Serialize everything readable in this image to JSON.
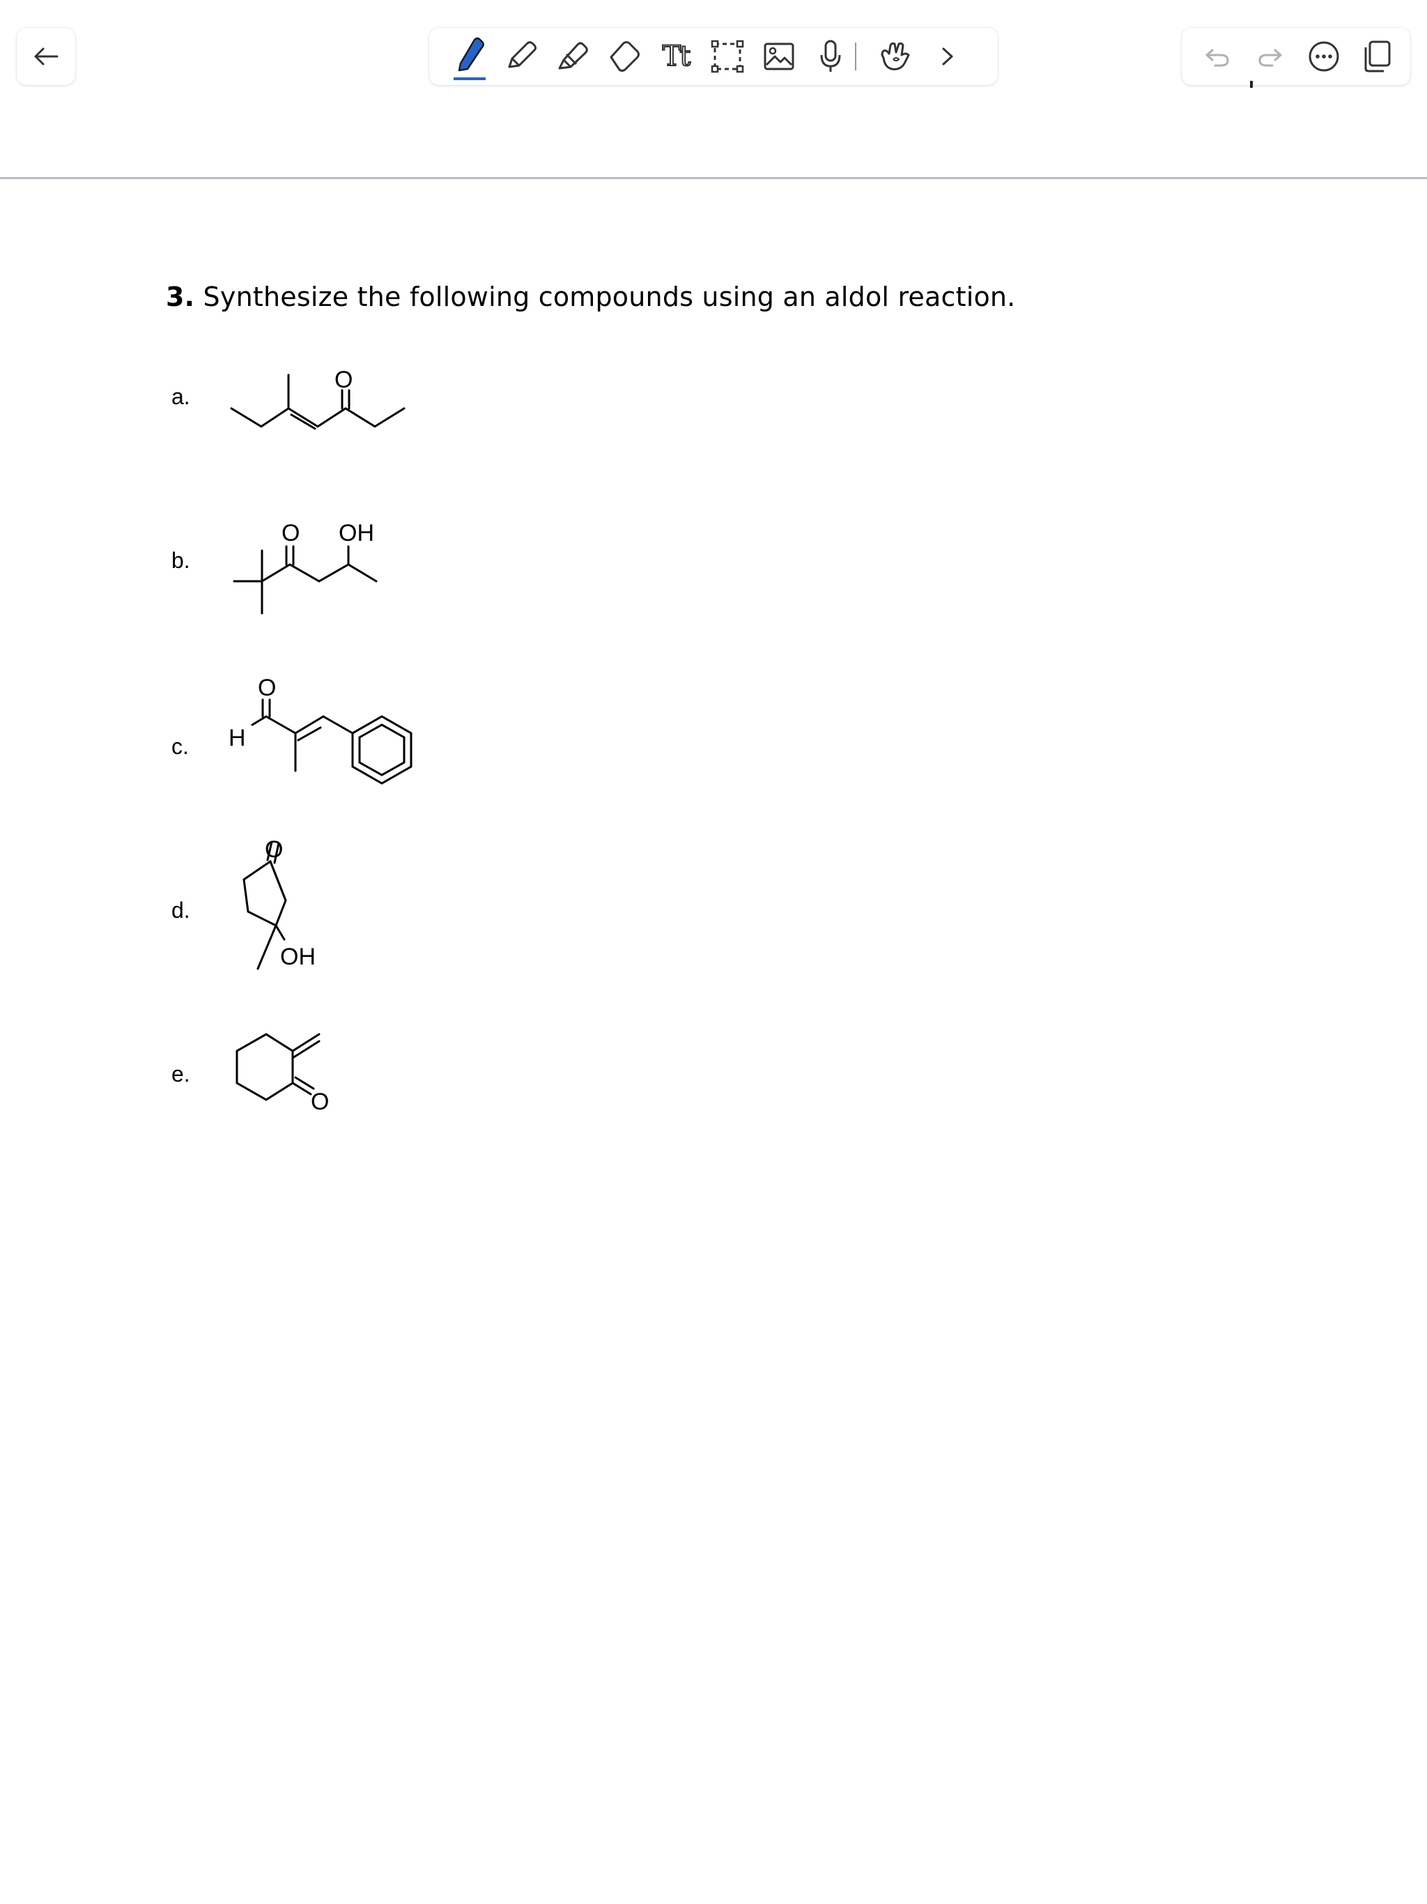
{
  "nav": {
    "back_icon": "arrow-left-icon"
  },
  "toolbar": {
    "tools": [
      {
        "name": "pen-tool",
        "icon": "pen-filled-icon",
        "active": true
      },
      {
        "name": "pencil-tool",
        "icon": "pencil-icon",
        "active": false
      },
      {
        "name": "highlighter-tool",
        "icon": "highlighter-icon",
        "active": false
      },
      {
        "name": "eraser-tool",
        "icon": "eraser-icon",
        "active": false
      },
      {
        "name": "text-tool",
        "icon": "text-icon",
        "active": false
      },
      {
        "name": "lasso-select-tool",
        "icon": "lasso-select-icon",
        "active": false
      },
      {
        "name": "image-tool",
        "icon": "image-icon",
        "active": false
      },
      {
        "name": "record-audio-tool",
        "icon": "microphone-icon",
        "active": false
      },
      {
        "name": "touch-draw-tool",
        "icon": "hand-draw-icon",
        "active": false
      },
      {
        "name": "more-tools",
        "icon": "chevron-right-icon",
        "active": false
      }
    ],
    "text_glyph": "Tt",
    "accent_color": "#2563c9"
  },
  "right_tools": {
    "undo_icon": "undo-icon",
    "redo_icon": "redo-icon",
    "more_icon": "more-options-icon",
    "pages_icon": "pages-icon"
  },
  "document": {
    "question_number": "3.",
    "question_text": " Synthesize the following compounds using an aldol reaction.",
    "items": [
      {
        "label": "a."
      },
      {
        "label": "b.",
        "atoms": [
          "O",
          "OH"
        ]
      },
      {
        "label": "c.",
        "atoms": [
          "O",
          "H"
        ]
      },
      {
        "label": "d.",
        "atoms": [
          "O",
          "OH"
        ]
      },
      {
        "label": "e.",
        "atoms": [
          "O"
        ]
      }
    ],
    "atom_a": "O"
  }
}
